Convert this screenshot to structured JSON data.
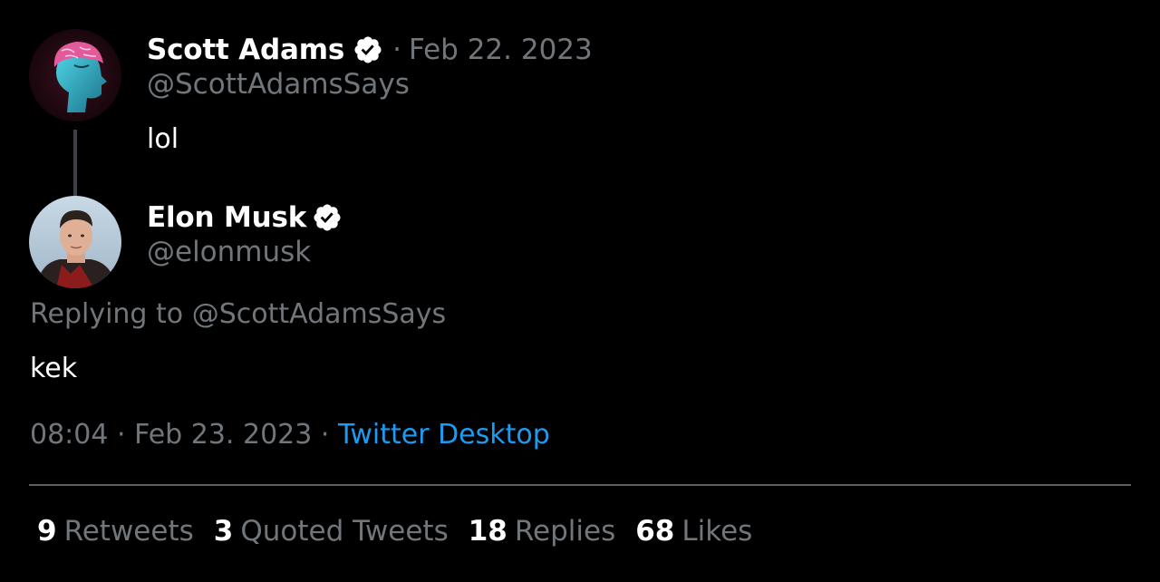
{
  "original_tweet": {
    "display_name": "Scott Adams",
    "verified": true,
    "separator": "·",
    "date": "Feb 22. 2023",
    "handle": "@ScottAdamsSays",
    "text": "lol",
    "avatar_icon": "brain-head-avatar"
  },
  "reply_tweet": {
    "display_name": "Elon Musk",
    "verified": true,
    "handle": "@elonmusk",
    "replying_prefix": "Replying to",
    "replying_handle": "@ScottAdamsSays",
    "text": "kek",
    "time": "08:04",
    "separator": "·",
    "date": "Feb 23. 2023",
    "source": "Twitter Desktop",
    "avatar_icon": "person-avatar"
  },
  "stats": [
    {
      "count": "9",
      "label": "Retweets"
    },
    {
      "count": "3",
      "label": "Quoted Tweets"
    },
    {
      "count": "18",
      "label": "Replies"
    },
    {
      "count": "68",
      "label": "Likes"
    }
  ],
  "colors": {
    "background": "#000000",
    "primary_text": "#ffffff",
    "secondary_text": "#71767b",
    "link": "#1d9bf0",
    "verified_badge": "#ffffff"
  }
}
